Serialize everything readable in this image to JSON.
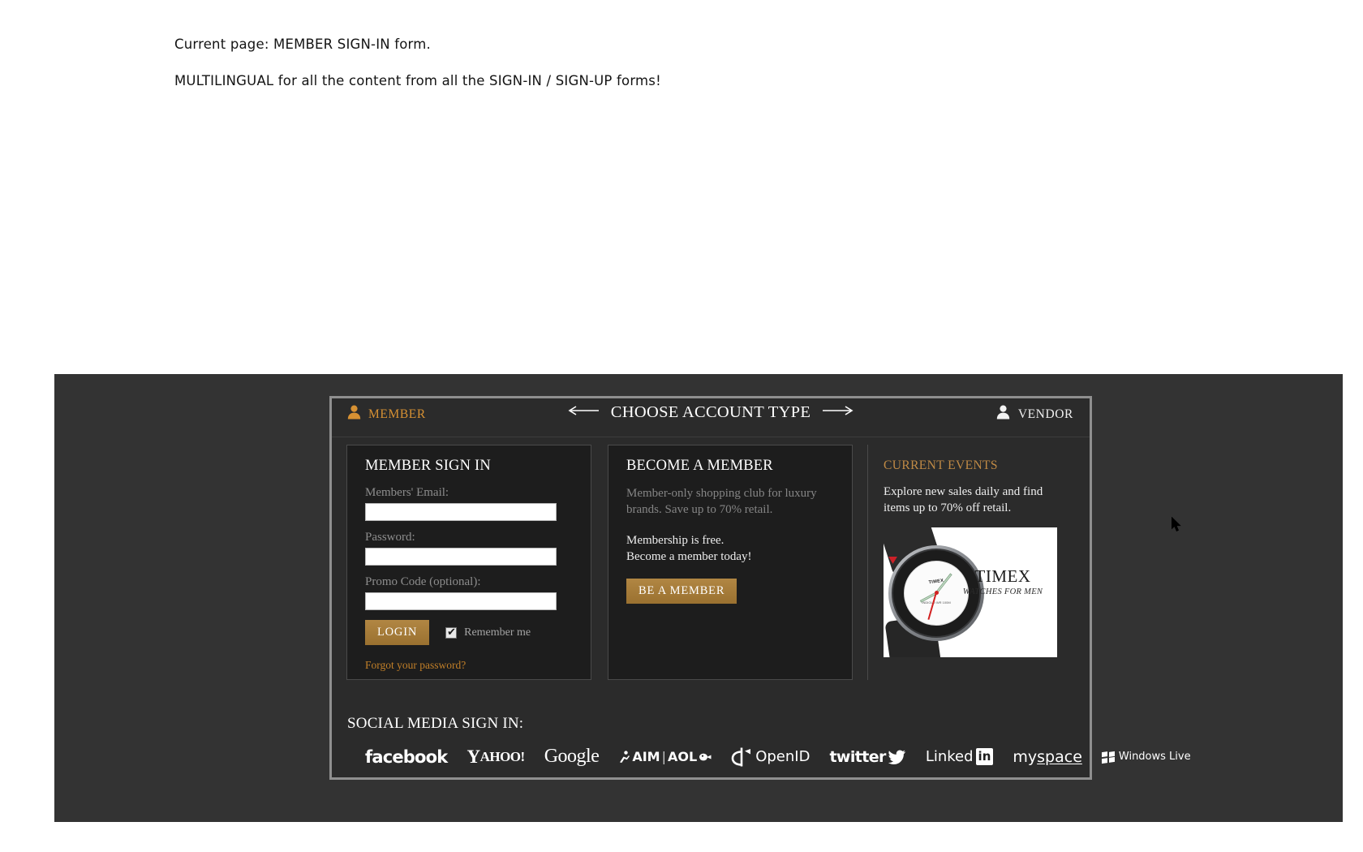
{
  "annotations": {
    "line1": "Current page: MEMBER SIGN-IN form.",
    "line2": "MULTILINGUAL for all the content from all the SIGN-IN / SIGN-UP forms!"
  },
  "account_header": {
    "member_label": "MEMBER",
    "member_icon": "person-icon",
    "title": "CHOOSE ACCOUNT TYPE",
    "left_arrow_icon": "arrow-left-icon",
    "right_arrow_icon": "arrow-right-icon",
    "vendor_label": "VENDOR",
    "vendor_icon": "person-icon",
    "member_color": "#d79133",
    "vendor_color": "#f0f0f0"
  },
  "signin": {
    "title": "MEMBER SIGN IN",
    "email_label": "Members' Email:",
    "email_value": "",
    "email_placeholder": "",
    "password_label": "Password:",
    "password_value": "",
    "password_placeholder": "",
    "promo_label": "Promo Code (optional):",
    "promo_value": "",
    "promo_placeholder": "",
    "login_button": "LOGIN",
    "remember_label": "Remember me",
    "remember_checked": "true",
    "forgot_link": "Forgot your password?",
    "link_color": "#c17f28",
    "button_color": "#9a7130"
  },
  "become": {
    "title": "BECOME A MEMBER",
    "description_line1": "Member-only shopping club for luxury",
    "description_line2": "brands. Save up to 70% retail.",
    "cta_line1": "Membership is free.",
    "cta_line2": "Become a member today!",
    "button": "BE A MEMBER"
  },
  "events": {
    "title": "CURRENT EVENTS",
    "text_line1": "Explore new sales daily and find",
    "text_line2": "items up to 70% off retail.",
    "title_color": "#c08a45",
    "ad": {
      "brand": "TIMEX",
      "tagline": "WATCHES FOR MEN",
      "dial_brand": "TIMEX",
      "dial_model": "EXPEDITION",
      "dial_sub": "INDIGLO WR 100M"
    }
  },
  "social": {
    "title": "SOCIAL MEDIA SIGN IN:",
    "providers": [
      {
        "name": "facebook",
        "label": "facebook"
      },
      {
        "name": "yahoo",
        "label": "YAHOO!"
      },
      {
        "name": "google",
        "label": "Google"
      },
      {
        "name": "aim-aol",
        "label": "AIM|AOL"
      },
      {
        "name": "openid",
        "label": "OpenID"
      },
      {
        "name": "twitter",
        "label": "twitter"
      },
      {
        "name": "linkedin",
        "label": "Linked"
      },
      {
        "name": "myspace",
        "label": "myspace"
      },
      {
        "name": "windows-live",
        "label": "Windows Live"
      }
    ],
    "yahoo_main": "Y",
    "yahoo_rest": "AHOO!",
    "google_label": "Google",
    "aim_label": "AIM",
    "aol_label": "AOL",
    "openid_label": "OpenID",
    "twitter_label": "twitter",
    "linkedin_label": "Linked",
    "linkedin_box": "in",
    "myspace_prefix": "my",
    "myspace_suffix": "space",
    "winlive_label": "Windows Live"
  }
}
